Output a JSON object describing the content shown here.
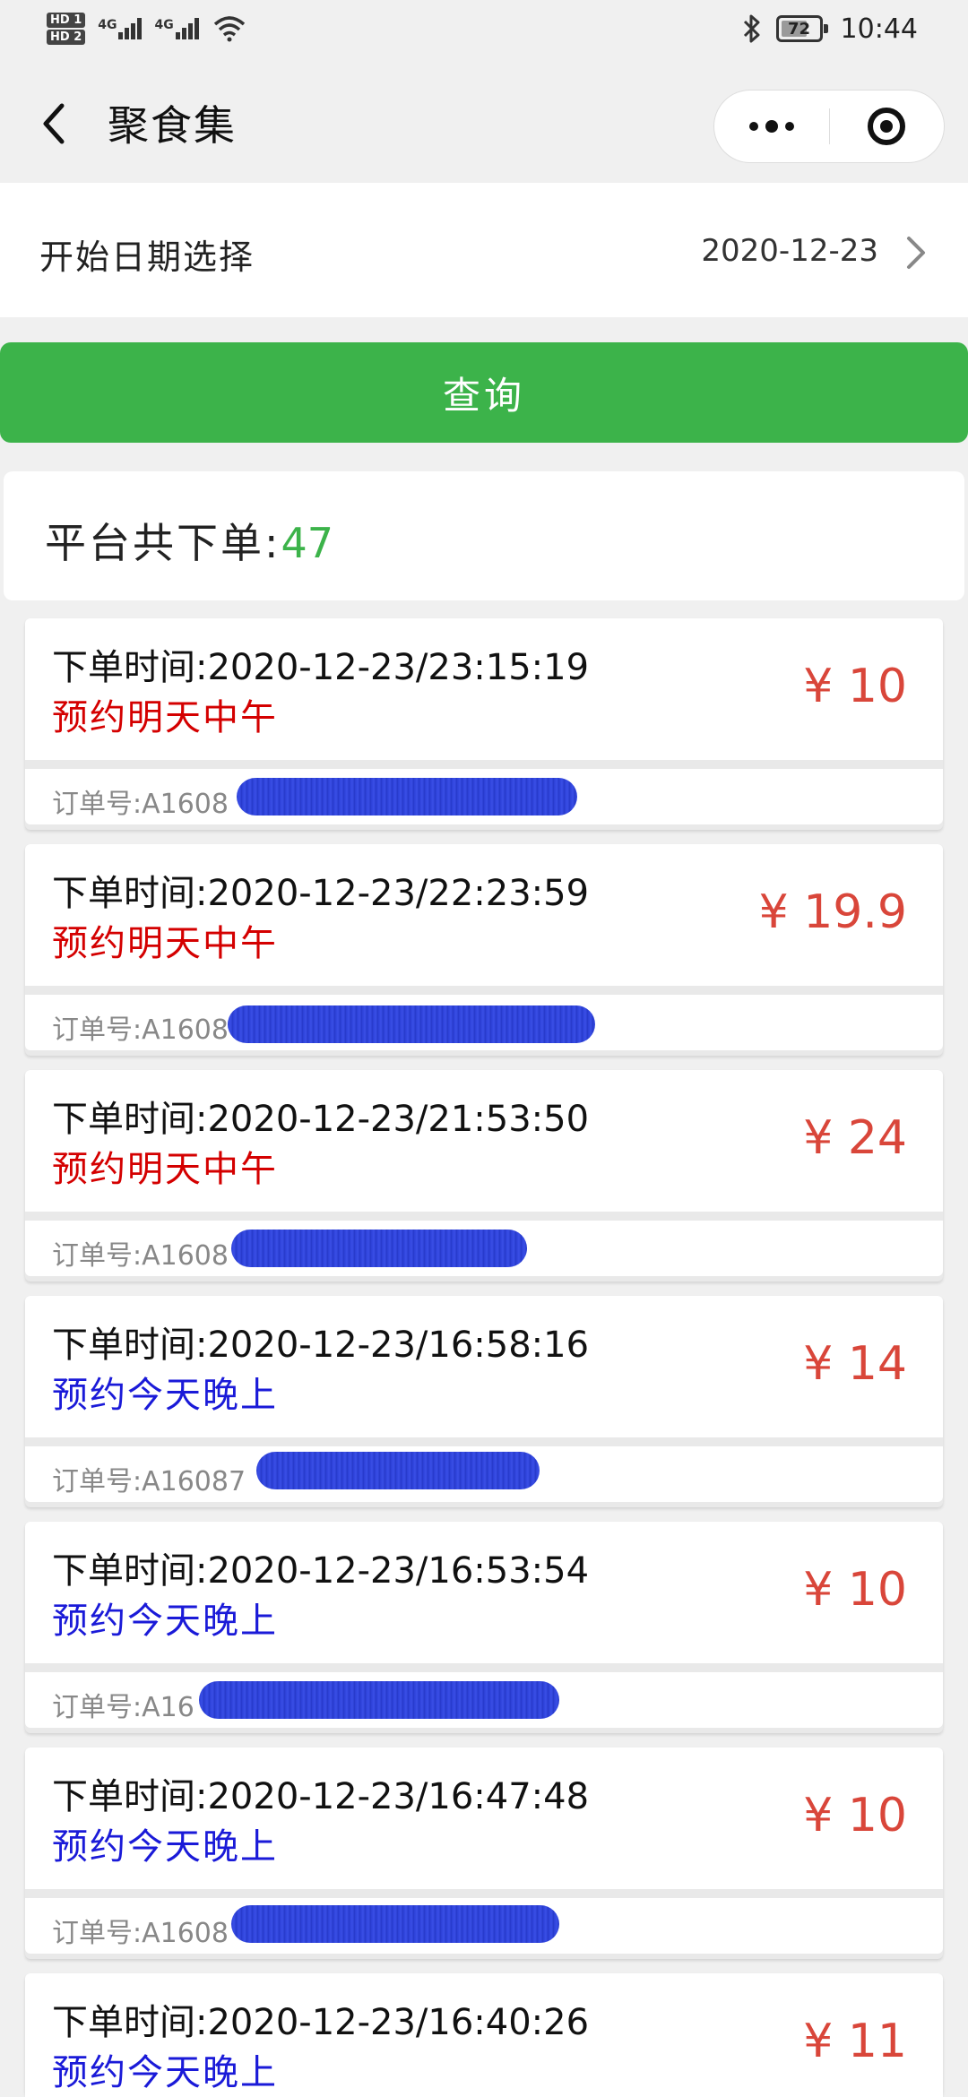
{
  "status_bar": {
    "left_badges": [
      "HD 1",
      "HD 2"
    ],
    "network_label_1": "4G",
    "network_label_2": "4G",
    "battery_level": "72",
    "battery_fraction": 0.72,
    "time": "10:44",
    "icons": [
      "signal-icon",
      "wifi-icon",
      "bluetooth-icon",
      "battery-icon"
    ]
  },
  "nav": {
    "back_icon": "chevron-left-icon",
    "title": "聚食集",
    "more_icon": "more-dots-icon",
    "close_icon": "target-icon"
  },
  "date_picker": {
    "label": "开始日期选择",
    "value": "2020-12-23",
    "arrow_icon": "chevron-right-icon"
  },
  "query_button": {
    "label": "查询",
    "color": "#3cb34a"
  },
  "summary": {
    "label": "平台共下单:",
    "count": "47"
  },
  "orders": [
    {
      "time": "下单时间:2020-12-23/23:15:19",
      "slot": "预约明天中午",
      "slot_color": "red",
      "price": "¥ 10",
      "order_no": "订单号:A1608"
    },
    {
      "time": "下单时间:2020-12-23/22:23:59",
      "slot": "预约明天中午",
      "slot_color": "red",
      "price": "¥ 19.9",
      "order_no": "订单号:A1608"
    },
    {
      "time": "下单时间:2020-12-23/21:53:50",
      "slot": "预约明天中午",
      "slot_color": "red",
      "price": "¥ 24",
      "order_no": "订单号:A1608"
    },
    {
      "time": "下单时间:2020-12-23/16:58:16",
      "slot": "预约今天晚上",
      "slot_color": "blue",
      "price": "¥ 14",
      "order_no": "订单号:A16087"
    },
    {
      "time": "下单时间:2020-12-23/16:53:54",
      "slot": "预约今天晚上",
      "slot_color": "blue",
      "price": "¥ 10",
      "order_no": "订单号:A16"
    },
    {
      "time": "下单时间:2020-12-23/16:47:48",
      "slot": "预约今天晚上",
      "slot_color": "blue",
      "price": "¥ 10",
      "order_no": "订单号:A1608"
    },
    {
      "time": "下单时间:2020-12-23/16:40:26",
      "slot": "预约今天晚上",
      "slot_color": "blue",
      "price": "¥ 11",
      "order_no": ""
    }
  ],
  "colors": {
    "price": "#d9463a",
    "slot_red": "#d40000",
    "slot_blue": "#1a1ad8",
    "count_green": "#3cb34a"
  }
}
